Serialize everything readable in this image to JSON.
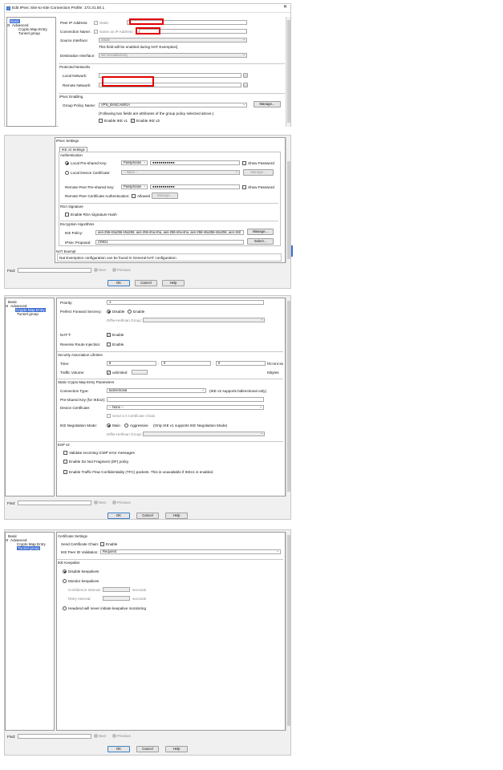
{
  "window": {
    "title": "Edit IPsec Site-to-Site Connection Profile: 172.31.50.1",
    "close": "✕"
  },
  "tree": {
    "basic": "Basic",
    "advanced": "Advanced",
    "crypto": "Crypto Map Entry",
    "tunnel": "Tunnel group"
  },
  "basic": {
    "peer_ip_label": "Peer IP Address:",
    "static_label": "Static",
    "conn_name_label": "Connection Name:",
    "same_as_ip_label": "Same as IP Address",
    "source_if_label": "Source Interface:",
    "source_if_value": "inside",
    "nat_note": "This field will be enabled during NAT Exemption]",
    "dest_if_label": "Destination Interface:",
    "dest_if_value": "ser-vicioabancos]",
    "protected_networks": "Protected Networks",
    "local_net_label": "Local Network:",
    "remote_net_label": "Remote Network:",
    "ipsec_enabling": "IPsec Enabling",
    "group_policy_label": "Group Policy Name:",
    "group_policy_value": "VPN_BANCAMIGA",
    "manage": "Manage...",
    "group_note": "(Following two fields are attributes of the group policy selected above.)",
    "enable_ikev1": "Enable IKE v1",
    "enable_ikev2": "Enable IKE v2"
  },
  "ipsec": {
    "section": "IPsec Settings",
    "tab": "IKE v2 Settings",
    "authentication": "Authentication",
    "local_psk_label": "Local Pre-shared Key:",
    "passphrase": "Passphrase",
    "password_mask": "●●●●●●●●●●●",
    "show_password": "Show Password",
    "local_cert_label": "Local Device Certificate:",
    "none": "-- None --",
    "manage": "Manage...",
    "remote_psk_label": "Remote Peer Pre-shared Key:",
    "remote_cert_label": "Remote Peer Certificate Authentication:",
    "allowed": "Allowed",
    "rsa_signature": "RSA Signature",
    "enable_rsa_hash": "Enable RSA Signature Hash",
    "encryption_algorithms": "Encryption Algorithms",
    "ike_policy_label": "IKE Policy:",
    "ike_policy_value": "aes-256-sha256-sha256, aes-256-sha-sha, aes-256-sha-sha, aes-256-sha256-sha256, aes-192",
    "ipsec_proposal_label": "IPsec Proposal:",
    "ipsec_proposal_value": "CRID1",
    "select": "Select...",
    "nat_exempt": "NAT Exempt",
    "nat_exempt_note": "Nat Exemption configuration can be found in General NAT configuration"
  },
  "footer": {
    "find": "Find:",
    "next": "Next",
    "previous": "Previous",
    "ok": "OK",
    "cancel": "Cancel",
    "help": "Help"
  },
  "crypto": {
    "priority_label": "Priority:",
    "priority_value": "1",
    "pfs_label": "Perfect Forward Secrecy:",
    "disable": "Disable",
    "enable": "Enable",
    "dh_label": "Diffie-Hellman Group:",
    "natt_label": "NAT-T:",
    "rri_label": "Reverse Route Injection:",
    "sa_lifetime": "Security Association Lifetime",
    "time_label": "Time:",
    "time_h": "8",
    "time_m": "0",
    "time_s": "0",
    "colon": ":",
    "hms": "hh:mm:ss",
    "traffic_label": "Traffic Volume:",
    "unlimited": "unlimited",
    "kbytes": "KBytes",
    "static_params": "Static Crypto Map Entry Parameters",
    "conn_type_label": "Connection Type:",
    "conn_type_value": "bidirectional",
    "conn_type_note": "(IKE v2 supports bidirectional only)",
    "psk_ikev2_label": "Pre-shared Key (for IKEv2):",
    "device_cert_label": "Device Certificate:",
    "none": "-- None --",
    "send_ca": "Send CA Certificate Chain",
    "ike_neg_label": "IKE Negotiation Mode:",
    "main": "Main",
    "aggressive": "Aggressive",
    "ike_neg_note": "(Only IKE v1 supports IKE Negotiation Mode)",
    "esp_v3": "ESP v3",
    "validate_icmp": "Validate incoming ICMP error messages",
    "enable_df": "Enable Do Not Fragment (DF) policy",
    "enable_tfc": "Enable Traffic Flow Confidentiality (TFC) packets. This is unavailable if IKEv1 is enabled."
  },
  "tunnel": {
    "cert_settings": "Certificate Settings",
    "send_chain_label": "Send Certificate Chain:",
    "enable": "Enable",
    "ike_peer_label": "IKE Peer ID Validation:",
    "ike_peer_value": "Required",
    "ike_keepalive": "IKE Keepalive",
    "disable_keepalives": "Disable keepalives",
    "monitor_keepalives": "Monitor keepalives",
    "confidence_label": "Confidence Interval:",
    "retry_label": "Retry Interval:",
    "seconds": "seconds",
    "headend": "Headend will never initiate keepalive monitoring"
  }
}
